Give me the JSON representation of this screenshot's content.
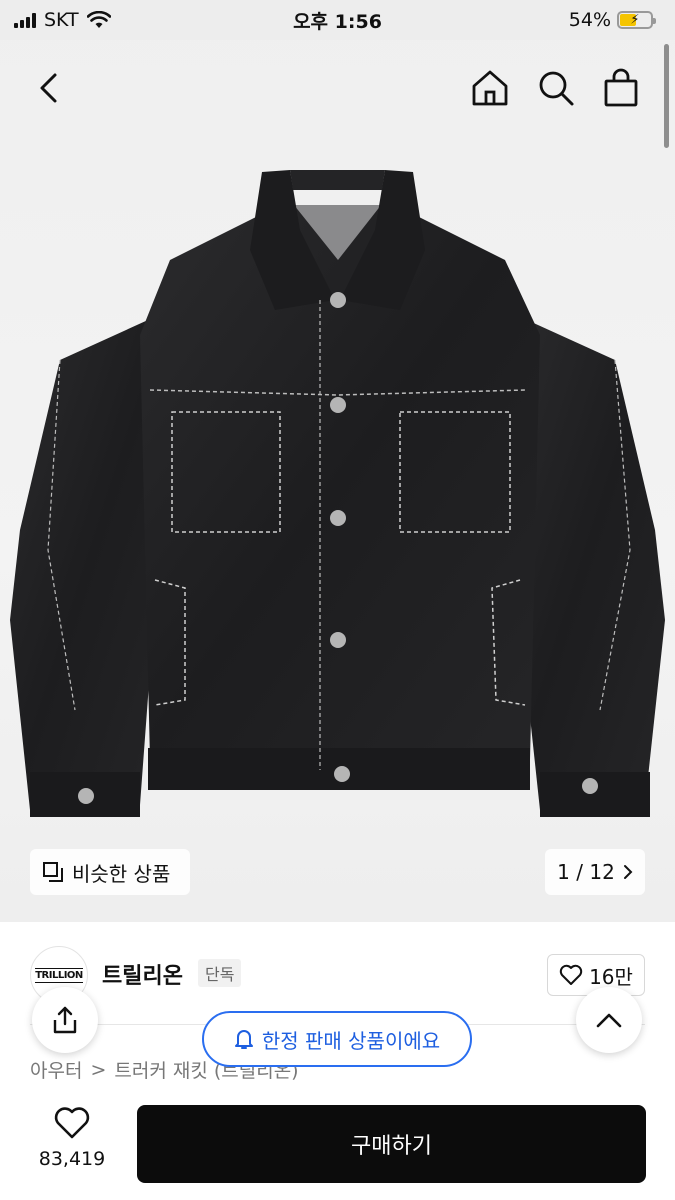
{
  "status_bar": {
    "carrier": "SKT",
    "time": "오후 1:56",
    "battery_percent": "54%",
    "battery_level": 0.54,
    "battery_color": "#f5c400"
  },
  "navbar": {
    "icons": [
      "back-chevron-icon",
      "home-icon",
      "search-icon",
      "shopping-bag-icon"
    ]
  },
  "gallery": {
    "similar_label": "비슷한 상품",
    "page_counter": "1 / 12"
  },
  "brand": {
    "logo_text": "TRILLION",
    "name": "트릴리온",
    "tag": "단독",
    "likes": "16만"
  },
  "breadcrumb": {
    "category": "아우터",
    "subcategory": "트러커 재킷 (트릴리온)"
  },
  "toast": {
    "label": "한정 판매 상품이에요",
    "accent": "#2a6ef0"
  },
  "bottom_bar": {
    "wish_count": "83,419",
    "buy_label": "구매하기"
  }
}
